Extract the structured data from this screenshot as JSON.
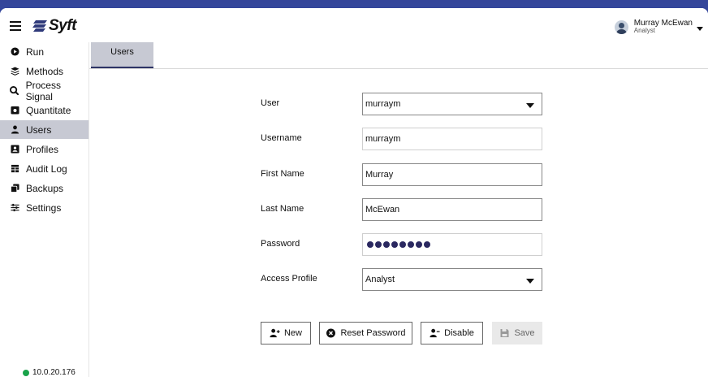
{
  "app": {
    "logo_text": "Syft"
  },
  "user_menu": {
    "name": "Murray McEwan",
    "role": "Analyst"
  },
  "sidebar": {
    "items": [
      {
        "label": "Run",
        "icon": "play-circle-icon"
      },
      {
        "label": "Methods",
        "icon": "layers-icon"
      },
      {
        "label": "Process Signal",
        "icon": "magnify-icon"
      },
      {
        "label": "Quantitate",
        "icon": "calculator-icon"
      },
      {
        "label": "Users",
        "icon": "user-icon",
        "active": true
      },
      {
        "label": "Profiles",
        "icon": "profile-card-icon"
      },
      {
        "label": "Audit Log",
        "icon": "table-icon"
      },
      {
        "label": "Backups",
        "icon": "copy-icon"
      },
      {
        "label": "Settings",
        "icon": "sliders-icon"
      }
    ],
    "ip_address": "10.0.20.176",
    "status_color": "#1aa34a"
  },
  "tabs": [
    {
      "label": "Users",
      "active": true
    }
  ],
  "form": {
    "user": {
      "label": "User",
      "value": "murraym"
    },
    "username": {
      "label": "Username",
      "value": "murraym"
    },
    "first_name": {
      "label": "First Name",
      "value": "Murray"
    },
    "last_name": {
      "label": "Last Name",
      "value": "McEwan"
    },
    "password": {
      "label": "Password",
      "mask_count": 8
    },
    "access_profile": {
      "label": "Access Profile",
      "value": "Analyst"
    }
  },
  "buttons": {
    "new": "New",
    "reset_password": "Reset Password",
    "disable": "Disable",
    "save": "Save"
  },
  "colors": {
    "accent": "#2e3466",
    "active_bg": "#c7c9d3"
  }
}
